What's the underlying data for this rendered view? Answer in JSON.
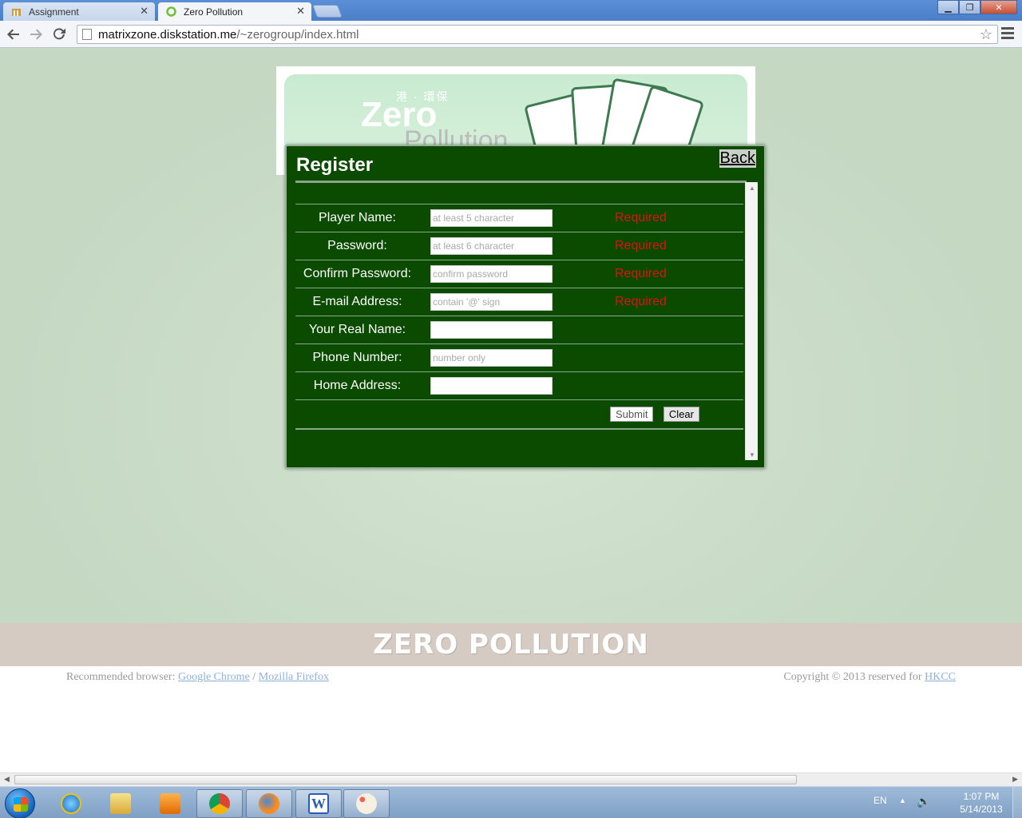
{
  "browser": {
    "tabs": [
      {
        "label": "Assignment",
        "active": false
      },
      {
        "label": "Zero Pollution",
        "active": true
      }
    ],
    "url_host": "matrixzone.diskstation.me",
    "url_path": "/~zerogroup/index.html",
    "icons": {
      "back": "back-arrow-icon",
      "forward": "forward-arrow-icon",
      "reload": "reload-icon",
      "star": "star-icon",
      "menu": "wrench-menu-icon"
    }
  },
  "banner": {
    "cn_text": "港 · 環保",
    "zero": "Zero",
    "pollution": "Pollution"
  },
  "dialog": {
    "title": "Register",
    "back_label": "Back",
    "fields": [
      {
        "label": "Player Name:",
        "placeholder": "at least 5 character",
        "required": "Required"
      },
      {
        "label": "Password:",
        "placeholder": "at least 6 character",
        "required": "Required"
      },
      {
        "label": "Confirm Password:",
        "placeholder": "confirm password",
        "required": "Required"
      },
      {
        "label": "E-mail Address:",
        "placeholder": "contain '@' sign",
        "required": "Required"
      },
      {
        "label": "Your Real Name:",
        "placeholder": "",
        "required": ""
      },
      {
        "label": "Phone Number:",
        "placeholder": "number only",
        "required": ""
      },
      {
        "label": "Home Address:",
        "placeholder": "",
        "required": ""
      }
    ],
    "submit_label": "Submit",
    "clear_label": "Clear"
  },
  "footer": {
    "logo_text": "ZERO POLLUTION",
    "recommended_prefix": "Recommended browser: ",
    "chrome_link": "Google Chrome",
    "separator": " / ",
    "firefox_link": "Mozilla Firefox",
    "copyright_prefix": "Copyright © 2013 reserved for ",
    "copyright_link": "HKCC"
  },
  "taskbar": {
    "apps": [
      "internet-explorer",
      "windows-explorer",
      "media-player",
      "chrome",
      "firefox",
      "word",
      "paint"
    ],
    "lang": "EN",
    "time": "1:07 PM",
    "date": "5/14/2013"
  },
  "colors": {
    "dialog_bg": "#0b4b00",
    "required": "#e01010",
    "page_bg": "#c8dbc6",
    "footer_band": "#d5cbc3"
  }
}
